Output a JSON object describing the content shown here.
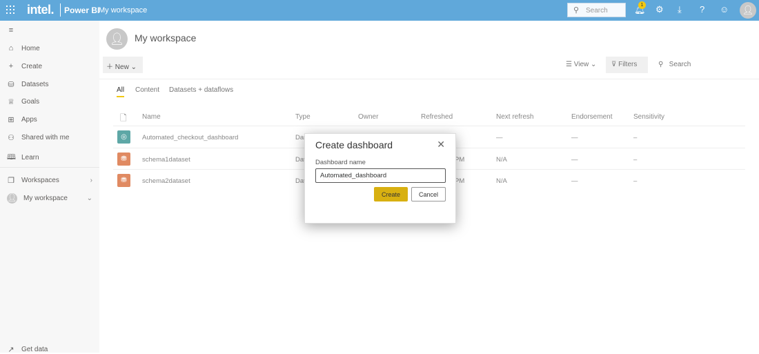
{
  "topbar": {
    "brand": "intel.",
    "product": "Power BI",
    "workspace": "My workspace",
    "search_placeholder": "Search",
    "notification_count": "1",
    "accent": "#60a8da"
  },
  "sidebar": {
    "items": [
      {
        "label": "Home",
        "icon": "home-icon"
      },
      {
        "label": "Create",
        "icon": "plus-icon"
      },
      {
        "label": "Datasets",
        "icon": "database-icon"
      },
      {
        "label": "Goals",
        "icon": "trophy-icon"
      },
      {
        "label": "Apps",
        "icon": "apps-icon"
      },
      {
        "label": "Shared with me",
        "icon": "shared-icon"
      },
      {
        "label": "Learn",
        "icon": "book-icon"
      }
    ],
    "workspaces": "Workspaces",
    "my_workspace": "My workspace",
    "get_data": "Get data"
  },
  "main": {
    "title": "My workspace",
    "new_label": "New",
    "view_label": "View",
    "filters_label": "Filters",
    "search_label": "Search",
    "tabs": [
      {
        "label": "All",
        "active": true
      },
      {
        "label": "Content"
      },
      {
        "label": "Datasets + dataflows"
      }
    ],
    "columns": [
      "Name",
      "Type",
      "Owner",
      "Refreshed",
      "Next refresh",
      "Endorsement",
      "Sensitivity"
    ],
    "rows": [
      {
        "name": "Automated_checkout_dashboard",
        "type": "Das",
        "refreshed": "",
        "next": "—",
        "endorsement": "—",
        "sensitivity": "–",
        "kind": "dashboard",
        "color": "#5ea7a6"
      },
      {
        "name": "schema1dataset",
        "type": "Dat",
        "refreshed": "PM",
        "next": "N/A",
        "endorsement": "—",
        "sensitivity": "–",
        "kind": "dataset",
        "color": "#e08a62"
      },
      {
        "name": "schema2dataset",
        "type": "Dat",
        "refreshed": "PM",
        "next": "N/A",
        "endorsement": "—",
        "sensitivity": "–",
        "kind": "dataset",
        "color": "#e08a62"
      }
    ]
  },
  "modal": {
    "title": "Create dashboard",
    "field_label": "Dashboard name",
    "field_value": "Automated_dashboard",
    "create": "Create",
    "cancel": "Cancel",
    "create_color": "#d8b011"
  }
}
